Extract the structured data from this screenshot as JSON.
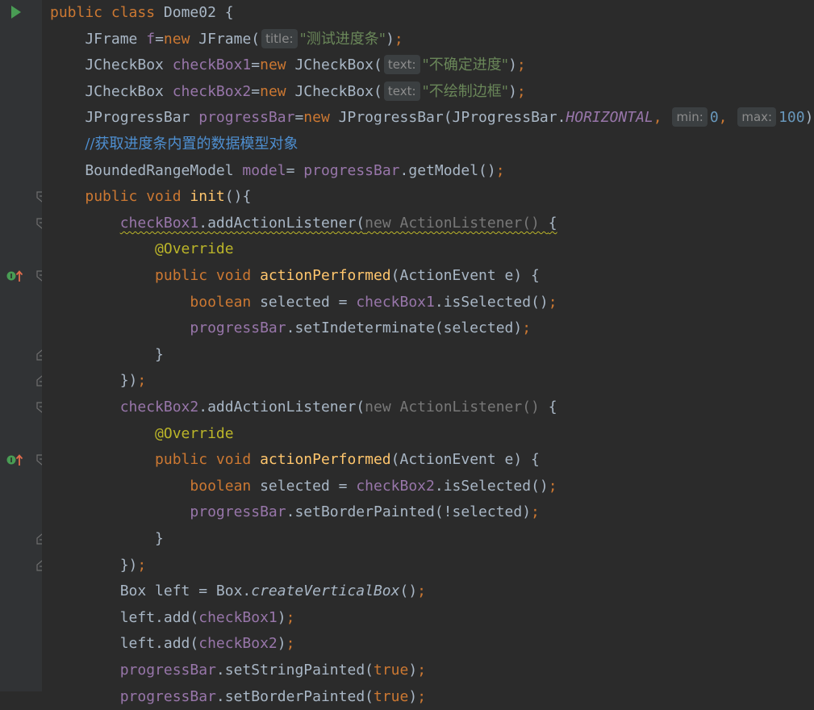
{
  "editor": {
    "lines": [
      {
        "tokens": [
          [
            "kw",
            "public "
          ],
          [
            "kw",
            "class "
          ],
          [
            "pln",
            "Dome02 {"
          ]
        ]
      },
      {
        "tokens": [
          [
            "pln",
            "    JFrame "
          ],
          [
            "fld",
            "f"
          ],
          [
            "pln",
            "="
          ],
          [
            "kw",
            "new "
          ],
          [
            "pln",
            "JFrame("
          ],
          [
            "hint",
            "title:"
          ],
          [
            "str",
            "\"测试进度条\""
          ],
          [
            "pln",
            ")"
          ],
          [
            "kw",
            ";"
          ]
        ]
      },
      {
        "tokens": [
          [
            "pln",
            "    JCheckBox "
          ],
          [
            "fld",
            "checkBox1"
          ],
          [
            "pln",
            "="
          ],
          [
            "kw",
            "new "
          ],
          [
            "pln",
            "JCheckBox("
          ],
          [
            "hint",
            "text:"
          ],
          [
            "str",
            "\"不确定进度\""
          ],
          [
            "pln",
            ")"
          ],
          [
            "kw",
            ";"
          ]
        ]
      },
      {
        "tokens": [
          [
            "pln",
            "    JCheckBox "
          ],
          [
            "fld",
            "checkBox2"
          ],
          [
            "pln",
            "="
          ],
          [
            "kw",
            "new "
          ],
          [
            "pln",
            "JCheckBox("
          ],
          [
            "hint",
            "text:"
          ],
          [
            "str",
            "\"不绘制边框\""
          ],
          [
            "pln",
            ")"
          ],
          [
            "kw",
            ";"
          ]
        ]
      },
      {
        "tokens": [
          [
            "pln",
            "    JProgressBar "
          ],
          [
            "fld",
            "progressBar"
          ],
          [
            "pln",
            "="
          ],
          [
            "kw",
            "new "
          ],
          [
            "pln",
            "JProgressBar(JProgressBar."
          ],
          [
            "st",
            "HORIZONTAL"
          ],
          [
            "kw",
            ", "
          ],
          [
            "hint",
            "min:"
          ],
          [
            "num",
            "0"
          ],
          [
            "kw",
            ", "
          ],
          [
            "hint",
            "max:"
          ],
          [
            "num",
            "100"
          ],
          [
            "pln",
            ")"
          ]
        ]
      },
      {
        "tokens": [
          [
            "pln",
            "    "
          ],
          [
            "cmz",
            "//获取进度条内置的数据模型对象"
          ]
        ]
      },
      {
        "tokens": [
          [
            "pln",
            "    BoundedRangeModel "
          ],
          [
            "fld",
            "model"
          ],
          [
            "pln",
            "= "
          ],
          [
            "fld",
            "progressBar"
          ],
          [
            "pln",
            ".getModel()"
          ],
          [
            "kw",
            ";"
          ]
        ]
      },
      {
        "tokens": [
          [
            "pln",
            "    "
          ],
          [
            "kw",
            "public "
          ],
          [
            "kw",
            "void "
          ],
          [
            "fn",
            "init"
          ],
          [
            "pln",
            "(){"
          ]
        ]
      },
      {
        "tokens": [
          [
            "pln",
            "        "
          ],
          [
            "sqf",
            "checkBox1"
          ],
          [
            "sqp",
            ".addActionListener("
          ],
          [
            "sqd",
            "new ActionListener() "
          ],
          [
            "sqp",
            "{"
          ]
        ]
      },
      {
        "tokens": [
          [
            "pln",
            "            "
          ],
          [
            "ann",
            "@Override"
          ]
        ]
      },
      {
        "tokens": [
          [
            "pln",
            "            "
          ],
          [
            "kw",
            "public "
          ],
          [
            "kw",
            "void "
          ],
          [
            "fn",
            "actionPerformed"
          ],
          [
            "pln",
            "(ActionEvent e) {"
          ]
        ]
      },
      {
        "tokens": [
          [
            "pln",
            "                "
          ],
          [
            "kw",
            "boolean "
          ],
          [
            "pln",
            "selected = "
          ],
          [
            "fld",
            "checkBox1"
          ],
          [
            "pln",
            ".isSelected()"
          ],
          [
            "kw",
            ";"
          ]
        ]
      },
      {
        "tokens": [
          [
            "pln",
            "                "
          ],
          [
            "fld",
            "progressBar"
          ],
          [
            "pln",
            ".setIndeterminate(selected)"
          ],
          [
            "kw",
            ";"
          ]
        ]
      },
      {
        "tokens": [
          [
            "pln",
            "            }"
          ]
        ]
      },
      {
        "tokens": [
          [
            "pln",
            "        })"
          ],
          [
            "kw",
            ";"
          ]
        ]
      },
      {
        "tokens": [
          [
            "pln",
            "        "
          ],
          [
            "fld",
            "checkBox2"
          ],
          [
            "pln",
            ".addActionListener("
          ],
          [
            "dim",
            "new ActionListener() "
          ],
          [
            "pln",
            "{"
          ]
        ]
      },
      {
        "tokens": [
          [
            "pln",
            "            "
          ],
          [
            "ann",
            "@Override"
          ]
        ]
      },
      {
        "tokens": [
          [
            "pln",
            "            "
          ],
          [
            "kw",
            "public "
          ],
          [
            "kw",
            "void "
          ],
          [
            "fn",
            "actionPerformed"
          ],
          [
            "pln",
            "(ActionEvent e) {"
          ]
        ]
      },
      {
        "tokens": [
          [
            "pln",
            "                "
          ],
          [
            "kw",
            "boolean "
          ],
          [
            "pln",
            "selected = "
          ],
          [
            "fld",
            "checkBox2"
          ],
          [
            "pln",
            ".isSelected()"
          ],
          [
            "kw",
            ";"
          ]
        ]
      },
      {
        "tokens": [
          [
            "pln",
            "                "
          ],
          [
            "fld",
            "progressBar"
          ],
          [
            "pln",
            ".setBorderPainted(!selected)"
          ],
          [
            "kw",
            ";"
          ]
        ]
      },
      {
        "tokens": [
          [
            "pln",
            "            }"
          ]
        ]
      },
      {
        "tokens": [
          [
            "pln",
            "        })"
          ],
          [
            "kw",
            ";"
          ]
        ]
      },
      {
        "tokens": [
          [
            "pln",
            "        Box left = Box."
          ],
          [
            "sti",
            "createVerticalBox"
          ],
          [
            "pln",
            "()"
          ],
          [
            "kw",
            ";"
          ]
        ]
      },
      {
        "tokens": [
          [
            "pln",
            "        left.add("
          ],
          [
            "fld",
            "checkBox1"
          ],
          [
            "pln",
            ")"
          ],
          [
            "kw",
            ";"
          ]
        ]
      },
      {
        "tokens": [
          [
            "pln",
            "        left.add("
          ],
          [
            "fld",
            "checkBox2"
          ],
          [
            "pln",
            ")"
          ],
          [
            "kw",
            ";"
          ]
        ]
      },
      {
        "tokens": [
          [
            "pln",
            "        "
          ],
          [
            "fld",
            "progressBar"
          ],
          [
            "pln",
            ".setStringPainted("
          ],
          [
            "kw",
            "true"
          ],
          [
            "pln",
            ")"
          ],
          [
            "kw",
            ";"
          ]
        ]
      },
      {
        "tokens": [
          [
            "pln",
            "        "
          ],
          [
            "fld",
            "progressBar"
          ],
          [
            "pln",
            ".setBorderPainted("
          ],
          [
            "kw",
            "true"
          ],
          [
            "pln",
            ")"
          ],
          [
            "kw",
            ";"
          ]
        ]
      }
    ]
  },
  "gutter": {
    "fold_markers": [
      {
        "line": 7,
        "kind": "open"
      },
      {
        "line": 8,
        "kind": "open"
      },
      {
        "line": 10,
        "kind": "open"
      },
      {
        "line": 13,
        "kind": "close"
      },
      {
        "line": 14,
        "kind": "close"
      },
      {
        "line": 15,
        "kind": "open"
      },
      {
        "line": 17,
        "kind": "open"
      },
      {
        "line": 20,
        "kind": "close"
      },
      {
        "line": 21,
        "kind": "close"
      }
    ],
    "implements_markers": [
      10,
      17
    ],
    "run_marker_line": 0
  },
  "colors": {
    "background": "#2b2b2b",
    "gutter": "#313335",
    "keyword": "#cc7832",
    "field": "#9876aa",
    "string": "#6a8759",
    "number": "#6897bb",
    "method_decl": "#ffc66d",
    "comment": "#4e8fd1",
    "annotation": "#bbb529",
    "run": "#499c54"
  }
}
